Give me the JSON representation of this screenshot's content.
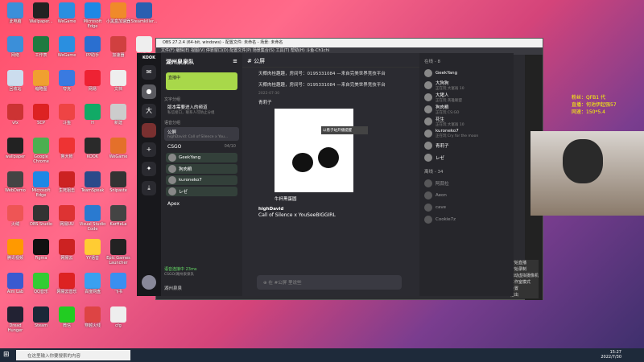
{
  "desktop_icons": [
    {
      "label": "此电脑",
      "color": "#3b8fd9"
    },
    {
      "label": "Wallpaper...",
      "color": "#222"
    },
    {
      "label": "WeGame",
      "color": "#2a8fe0"
    },
    {
      "label": "Microsoft Edge",
      "color": "#1e88e5"
    },
    {
      "label": "小黑盒加速器",
      "color": "#f08a2a"
    },
    {
      "label": "Steamkiller...",
      "color": "#2a5fb0"
    },
    {
      "label": "网络",
      "color": "#3b8fd9"
    },
    {
      "label": "工作表",
      "color": "#1f7a40"
    },
    {
      "label": "WeGame",
      "color": "#2a8fe0"
    },
    {
      "label": "PP助手",
      "color": "#2a6fd0"
    },
    {
      "label": "加速器",
      "color": "#d04040"
    },
    {
      "label": "新建",
      "color": "#eee"
    },
    {
      "label": "回收站",
      "color": "#cde"
    },
    {
      "label": "缩略图",
      "color": "#f0a030"
    },
    {
      "label": "夸克",
      "color": "#3a7ae0"
    },
    {
      "label": "网易",
      "color": "#e23"
    },
    {
      "label": "文档",
      "color": "#eee"
    },
    {
      "label": "vfx",
      "color": "#c33"
    },
    {
      "label": "SCP",
      "color": "#d22"
    },
    {
      "label": "斗鱼",
      "color": "#e44"
    },
    {
      "label": "H",
      "color": "#1a6"
    },
    {
      "label": "新建",
      "color": "#ccc"
    },
    {
      "label": "wallpaper",
      "color": "#222"
    },
    {
      "label": "Google Chrome",
      "color": "#4caf50"
    },
    {
      "label": "鲁大师",
      "color": "#e33"
    },
    {
      "label": "KOOK",
      "color": "#2a2a2a"
    },
    {
      "label": "WeGame",
      "color": "#e4702a"
    },
    {
      "label": "WebDemo",
      "color": "#444"
    },
    {
      "label": "Microsoft Edge",
      "color": "#1e88e5"
    },
    {
      "label": "生死狙击",
      "color": "#c22"
    },
    {
      "label": "TeamSpeak",
      "color": "#2a4a8a"
    },
    {
      "label": "Snipaste",
      "color": "#333"
    },
    {
      "label": "火绒",
      "color": "#e55"
    },
    {
      "label": "OBS Studio",
      "color": "#333"
    },
    {
      "label": "网易UU",
      "color": "#d33"
    },
    {
      "label": "Visual Studio Code",
      "color": "#2a7ad0"
    },
    {
      "label": "KarHeLa",
      "color": "#444"
    },
    {
      "label": "腾讯视频",
      "color": "#f90"
    },
    {
      "label": "Figma",
      "color": "#111"
    },
    {
      "label": "网易云",
      "color": "#c22"
    },
    {
      "label": "YY语音",
      "color": "#fc3"
    },
    {
      "label": "Epic Games Launcher",
      "color": "#222"
    },
    {
      "label": "Aim Lab",
      "color": "#3a5ad0"
    },
    {
      "label": "QQ音乐",
      "color": "#3c3"
    },
    {
      "label": "网易云音乐",
      "color": "#d22"
    },
    {
      "label": "百度网盘",
      "color": "#3aa0f0"
    },
    {
      "label": "飞书",
      "color": "#3a8ff0"
    },
    {
      "label": "Dread Hunger",
      "color": "#223"
    },
    {
      "label": "Steam",
      "color": "#1b2838"
    },
    {
      "label": "微信",
      "color": "#2c2"
    },
    {
      "label": "穿越火线",
      "color": "#d44"
    },
    {
      "label": "cfg",
      "color": "#eee"
    }
  ],
  "obs": {
    "title": "OBS 27.2.4 (64-bit, windows) - 配置文件: 未命名 - 场景: 未命名",
    "menu": "文件(F)  编辑(E)  视图(V)  停靠窗口(D)  配置文件(P)  场景集合(S)  工具(T)  帮助(H)  斗鱼-Ch1chi"
  },
  "kook": {
    "logo": "KOOK",
    "rail": [
      "消息",
      "大",
      "大",
      "+",
      "发现",
      "下载"
    ],
    "server_name": "湖州泉泉队",
    "server_banner": "直播中",
    "categories": {
      "text": "文字分组",
      "voice": "语音分组"
    },
    "announcement_channel": "版本需要进入的频道",
    "announcement_sub": "私信接口，联系人可防止分组",
    "notice_channel": "公屏",
    "notice_sub": "highDavid: Call of Silence x You...",
    "voice_channel": "CSGO",
    "voice_count": "04/10",
    "voice_users": [
      "GeekYang",
      "狗肉粮",
      "kuroneko7",
      "レゼ"
    ],
    "apex_channel": "Apex",
    "voice_status": "语音连接中 23ms",
    "voice_sub": "CSGO/湖州泉泉队",
    "current_user": "湖州泉泉",
    "main_channel_title": "公屏",
    "messages": {
      "m1": "天椰肉桂趣趣，房间号：0195331084 —来自完美世界竞技平台",
      "m2": "天椰肉桂趣趣，房间号：0195331084 —来自完美世界竞技平台",
      "date": "2022-07-30",
      "sender2": "青莉子",
      "caption": "牛杯黑蛋圆",
      "sender3": "highDavid",
      "text3": "Call of Silence x YouSeeBIGGIRL",
      "tooltip": "以看子站开播提醒"
    },
    "input_placeholder": "在 #公屏 里说些",
    "members_online": "在线 - 8",
    "members": [
      {
        "name": "GeekYang",
        "status": ""
      },
      {
        "name": "大狗狗",
        "status": "正在玩 大富翁 10"
      },
      {
        "name": "大猪人",
        "status": "正在玩 英雄联盟"
      },
      {
        "name": "狗肉粮",
        "status": "正在玩 CS:GO"
      },
      {
        "name": "花生",
        "status": "正在玩 大富翁 10"
      },
      {
        "name": "kuroneko7",
        "status": "正在玩 Cry for the moon"
      },
      {
        "name": "青莉子",
        "status": ""
      },
      {
        "name": "レゼ",
        "status": ""
      }
    ],
    "members_offline": "离线 - 34",
    "offline": [
      "阿蒜拉",
      "Aeon",
      "cave",
      "Cookie7z"
    ]
  },
  "taskbar": {
    "search_placeholder": "在这里输入你要搜索的内容",
    "time": "15:27",
    "date": "2022/7/30"
  },
  "stream_overlay": {
    "line1": "粉丝：QFB1 代",
    "line2": "直播：何池伊起强57",
    "line3": "网速：150*5.4"
  }
}
